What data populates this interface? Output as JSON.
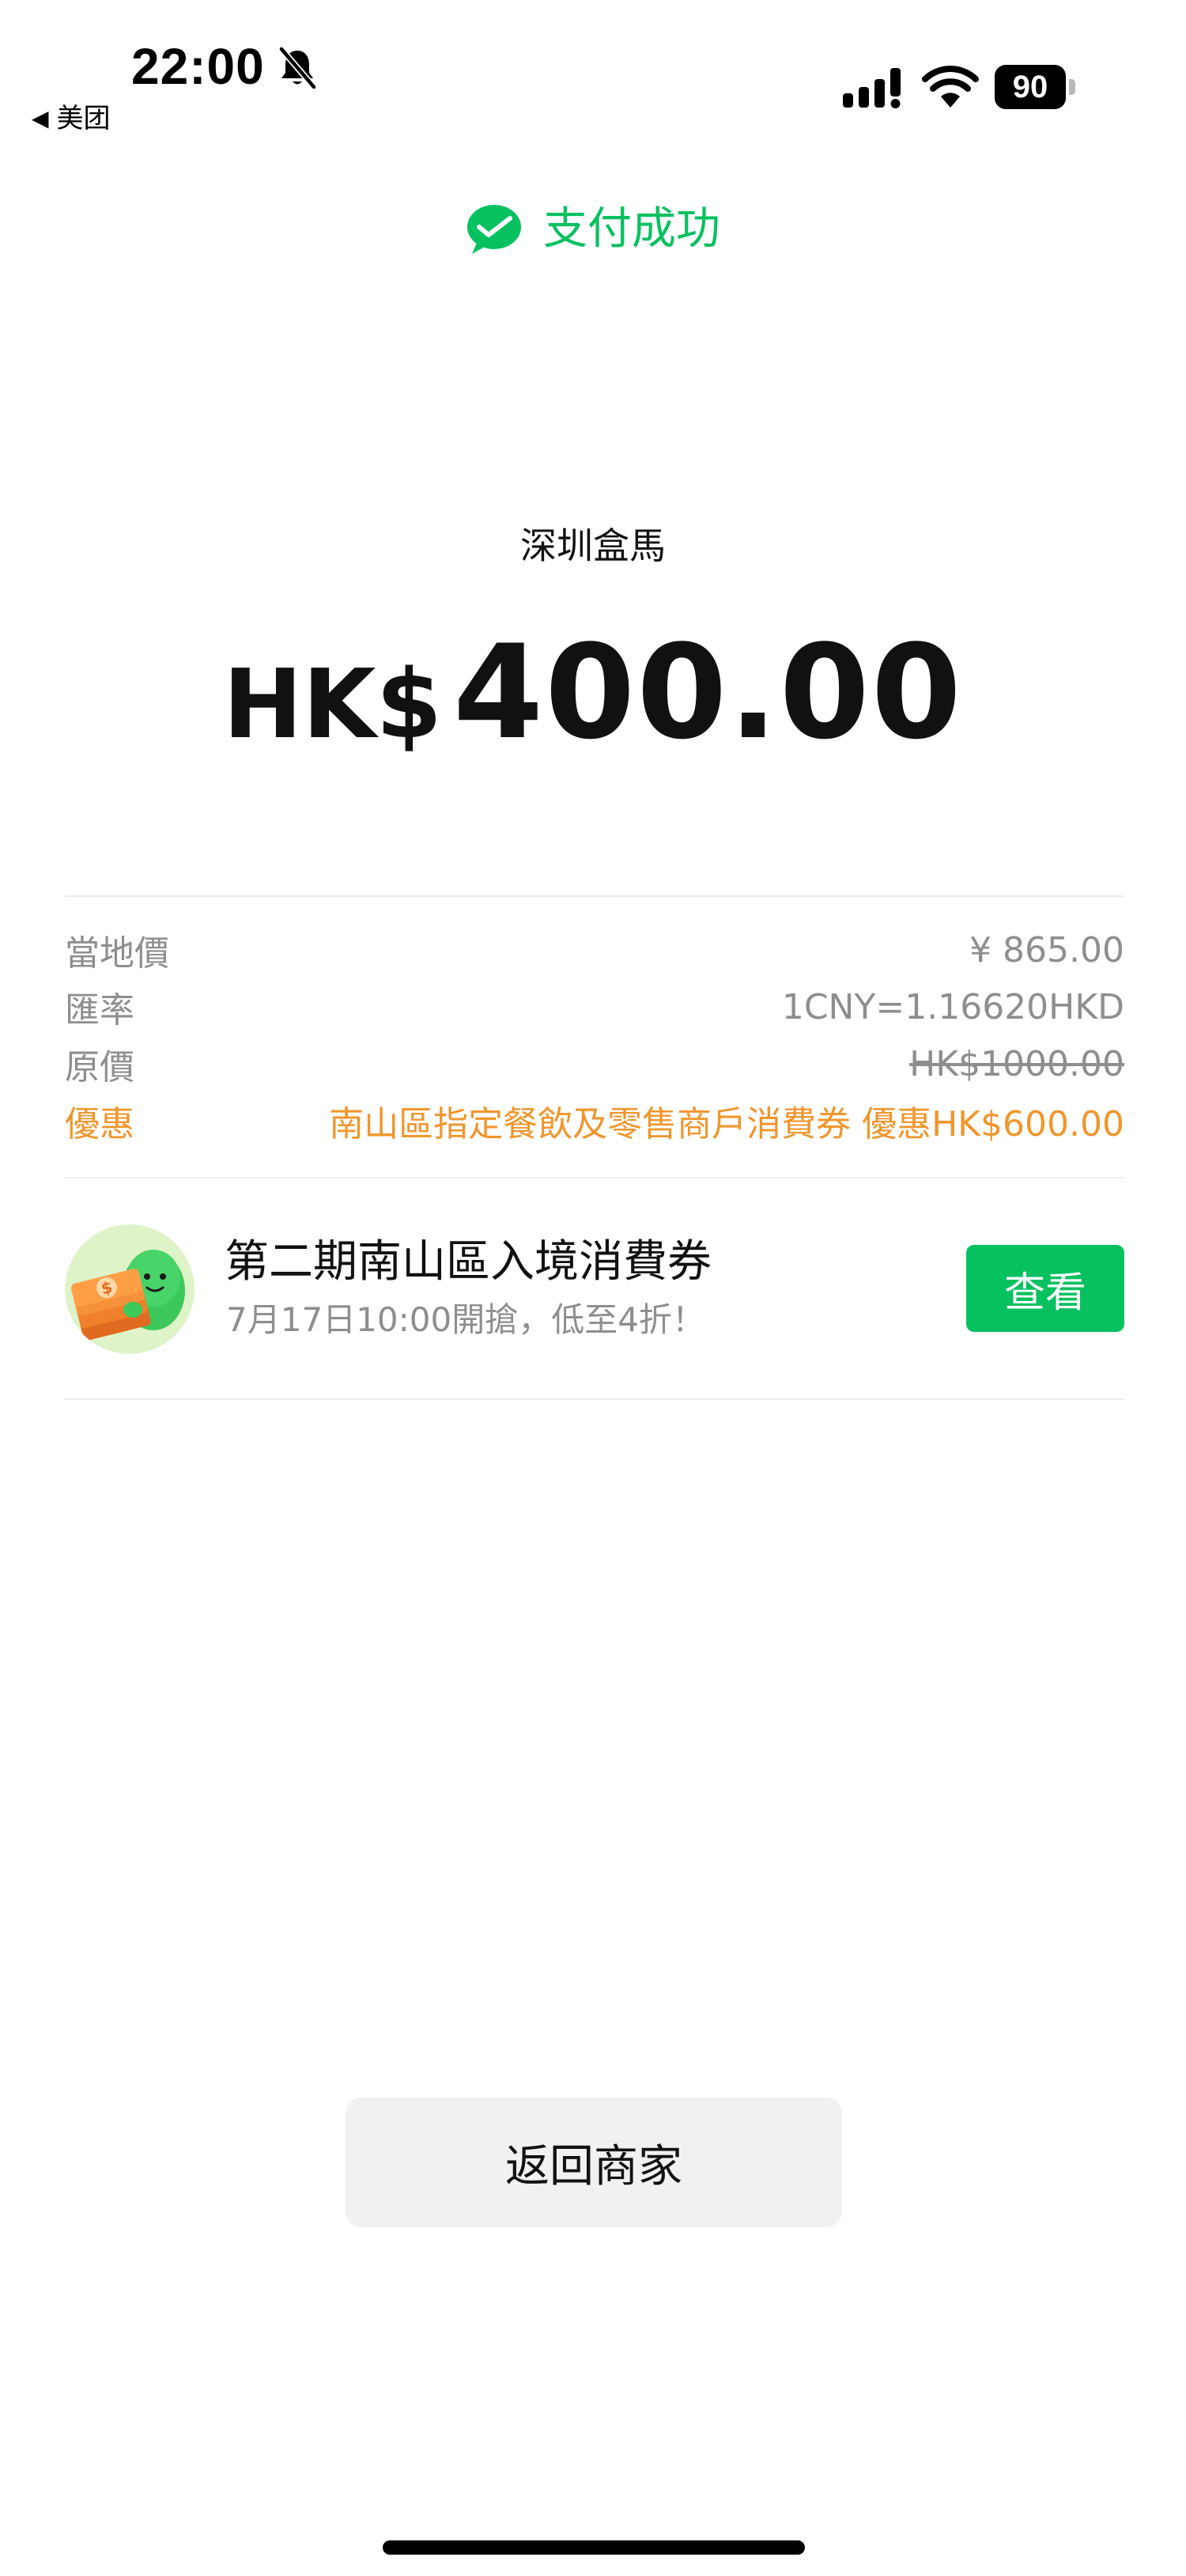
{
  "status_bar": {
    "time": "22:00",
    "back_app": "美团",
    "battery": "90",
    "icons": [
      "bell-slash-icon",
      "signal-icon",
      "wifi-icon",
      "battery-icon"
    ]
  },
  "header": {
    "title": "支付成功",
    "icon": "wechat-pay-check-icon",
    "accent_color": "#07c160"
  },
  "payment": {
    "merchant": "深圳盒馬",
    "currency": "HK$",
    "amount": "400.00"
  },
  "details": [
    {
      "label": "當地價",
      "value": "¥ 865.00"
    },
    {
      "label": "匯率",
      "value": "1CNY=1.16620HKD"
    },
    {
      "label": "原價",
      "value": "HK$1000.00"
    },
    {
      "label": "優惠",
      "value": "南山區指定餐飲及零售商戶消費券 優惠HK$600.00"
    }
  ],
  "promo": {
    "title": "第二期南山區入境消費券",
    "subtitle": "7月17日10:00開搶，低至4折！",
    "button": "查看"
  },
  "footer": {
    "return_button": "返回商家"
  },
  "colors": {
    "brand_green": "#07c160",
    "discount_orange": "#f0962d",
    "muted_text": "#8e8e8e"
  }
}
